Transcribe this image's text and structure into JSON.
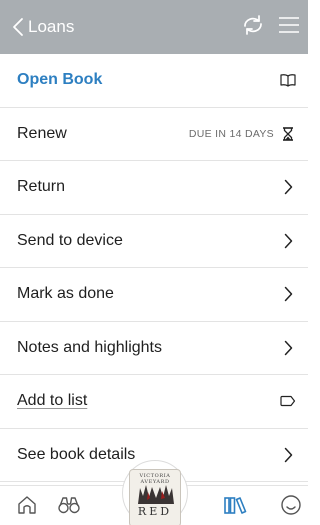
{
  "header": {
    "back_label": "Loans",
    "background": "#a9aeb2",
    "icons": [
      "chevron-left-icon",
      "sync-icon",
      "hamburger-menu-icon"
    ]
  },
  "menu": {
    "accent_color": "#2d7fc1",
    "items": [
      {
        "label": "Open Book",
        "icon": "open-book-icon"
      },
      {
        "label": "Renew",
        "badge": "DUE IN 14 DAYS",
        "icon": "hourglass-icon"
      },
      {
        "label": "Return",
        "icon": "chevron-right-icon"
      },
      {
        "label": "Send to device",
        "icon": "chevron-right-icon"
      },
      {
        "label": "Mark as done",
        "icon": "chevron-right-icon"
      },
      {
        "label": "Notes and highlights",
        "icon": "chevron-right-icon"
      },
      {
        "label": "Add to list",
        "icon": "tag-icon"
      },
      {
        "label": "See book details",
        "icon": "chevron-right-icon"
      }
    ]
  },
  "tabbar": {
    "tabs": [
      {
        "name": "home",
        "icon": "home-icon"
      },
      {
        "name": "explore",
        "icon": "binoculars-icon"
      },
      {
        "name": "shelf",
        "icon": "library-icon",
        "color": "#2d7fc1"
      },
      {
        "name": "feedback",
        "icon": "smiley-icon"
      }
    ]
  },
  "current_book": {
    "author": "VICTORIA AVEYARD",
    "title": "RED"
  }
}
